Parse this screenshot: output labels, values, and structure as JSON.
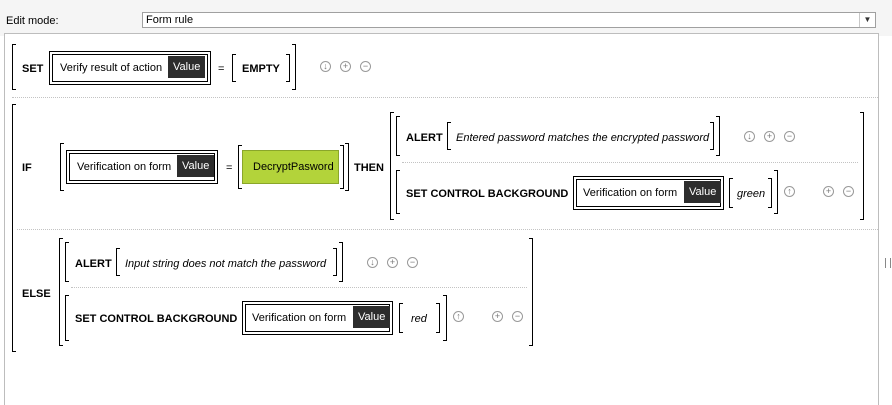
{
  "header": {
    "edit_mode_label": "Edit mode:",
    "edit_mode_value": "Form rule"
  },
  "rule": {
    "set": {
      "keyword": "SET",
      "target_label": "Verify result of action",
      "target_tag": "Value",
      "operator": "=",
      "value": "EMPTY"
    },
    "if": {
      "keyword": "IF",
      "left_label": "Verification on form",
      "left_tag": "Value",
      "operator": "=",
      "right_value": "DecryptPasword",
      "then_keyword": "THEN"
    },
    "then_actions": [
      {
        "keyword": "ALERT",
        "message": "Entered password matches the encrypted password"
      },
      {
        "keyword": "SET CONTROL BACKGROUND",
        "target_label": "Verification on form",
        "target_tag": "Value",
        "color": "green"
      }
    ],
    "else": {
      "keyword": "ELSE"
    },
    "else_actions": [
      {
        "keyword": "ALERT",
        "message": "Input string does not match the password"
      },
      {
        "keyword": "SET CONTROL BACKGROUND",
        "target_label": "Verification on form",
        "target_tag": "Value",
        "color": "red"
      }
    ]
  },
  "icons": {
    "down": "↓",
    "up": "↑",
    "add": "+",
    "remove": "−"
  },
  "colors": {
    "accent_green": "#b3d33a",
    "value_tag": "#2d2d2d"
  }
}
